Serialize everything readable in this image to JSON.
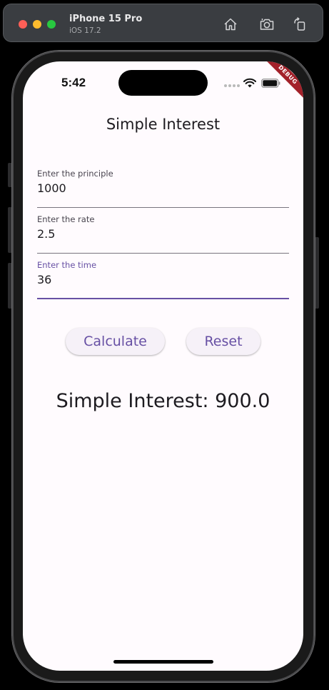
{
  "simulator": {
    "device_name": "iPhone 15 Pro",
    "os_version": "iOS 17.2",
    "toolbar_icons": [
      "home-icon",
      "screenshot-icon",
      "rotate-icon"
    ]
  },
  "status_bar": {
    "time": "5:42",
    "debug_banner": "DEBUG"
  },
  "app": {
    "title": "Simple Interest",
    "fields": [
      {
        "label": "Enter the principle",
        "value": "1000"
      },
      {
        "label": "Enter the rate",
        "value": "2.5"
      },
      {
        "label": "Enter the time",
        "value": "36",
        "focused": true
      }
    ],
    "buttons": {
      "calculate": "Calculate",
      "reset": "Reset"
    },
    "result": "Simple Interest: 900.0"
  },
  "colors": {
    "accent": "#6750a4",
    "background": "#fffbfe",
    "button_bg": "#f6f1f8",
    "debug_banner": "#a3212a"
  }
}
